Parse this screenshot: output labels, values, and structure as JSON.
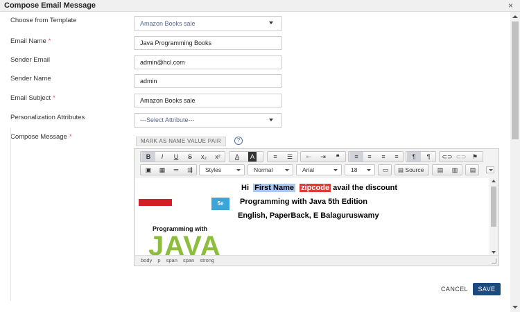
{
  "dialog": {
    "title": "Compose Email Message",
    "close_glyph": "×"
  },
  "form": {
    "template_label": "Choose from Template",
    "template_value": "Amazon Books sale",
    "email_name_label": "Email Name",
    "email_name_value": "Java Programming Books",
    "sender_email_label": "Sender Email",
    "sender_email_value": "admin@hcl.com",
    "sender_name_label": "Sender Name",
    "sender_name_value": "admin",
    "subject_label": "Email Subject",
    "subject_value": "Amazon Books sale",
    "personalization_label": "Personalization Attributes",
    "personalization_value": "---Select Attribute---",
    "compose_label": "Compose Message",
    "required_mark": "*"
  },
  "editor": {
    "mark_button": "MARK AS NAME VALUE PAIR",
    "help_glyph": "?",
    "toolbar": {
      "bold": "B",
      "italic": "I",
      "underline": "U",
      "strike": "S",
      "subscript": "x₂",
      "superscript": "x²",
      "text_color": "A",
      "bg_color": "A",
      "styles": "Styles",
      "format": "Normal",
      "font": "Arial",
      "size": "18",
      "source": "Source"
    },
    "content": {
      "greeting_prefix": "Hi",
      "first_name_token": "First Name",
      "zipcode_token": "zipcode",
      "greeting_suffix": "avail the discount",
      "line2": "Programming with Java 5th Edition",
      "line3": "English, PaperBack, E Balaguruswamy",
      "book_edition_badge": "5e",
      "book_title": "Programming with",
      "book_word": "JAVA"
    },
    "path": [
      "body",
      "p",
      "span",
      "span",
      "strong"
    ]
  },
  "actions": {
    "cancel": "CANCEL",
    "save": "SAVE"
  }
}
